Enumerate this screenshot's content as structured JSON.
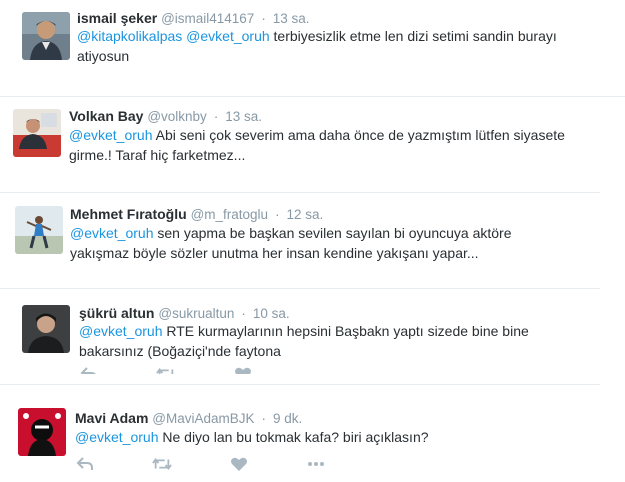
{
  "tweets": [
    {
      "name": "ismail şeker",
      "handle": "@ismail414167",
      "time": "13 sa.",
      "text_lines": [
        [
          {
            "t": "@kitapkolikalpas",
            "m": true
          },
          {
            "t": " ",
            "m": false
          },
          {
            "t": "@evket_oruh",
            "m": true
          },
          {
            "t": " terbiyesizlik  etme len dizi setimi sandin burayı",
            "m": false
          }
        ],
        [
          {
            "t": "atiyosun",
            "m": false
          }
        ]
      ]
    },
    {
      "name": "Volkan Bay",
      "handle": "@volknby",
      "time": "13 sa.",
      "text_lines": [
        [
          {
            "t": "@evket_oruh",
            "m": true
          },
          {
            "t": " Abi seni çok severim ama daha önce de yazmıştım lütfen siyasete",
            "m": false
          }
        ],
        [
          {
            "t": "girme.! Taraf hiç farketmez...",
            "m": false
          }
        ]
      ]
    },
    {
      "name": "Mehmet Fıratoğlu",
      "handle": "@m_fratoglu",
      "time": "12 sa.",
      "text_lines": [
        [
          {
            "t": "@evket_oruh",
            "m": true
          },
          {
            "t": " sen yapma be başkan sevilen sayılan bi oyuncuya aktöre",
            "m": false
          }
        ],
        [
          {
            "t": "yakışmaz böyle sözler unutma her insan kendine yakışanı yapar...",
            "m": false
          }
        ]
      ]
    },
    {
      "name": "şükrü altun",
      "handle": "@sukrualtun",
      "time": "10 sa.",
      "text_lines": [
        [
          {
            "t": "@evket_oruh",
            "m": true
          },
          {
            "t": " RTE kurmaylarının hepsini Başbakn yaptı sizede bine bine",
            "m": false
          }
        ],
        [
          {
            "t": "bakarsınız (Boğaziçi'nde faytona",
            "m": false
          }
        ]
      ]
    },
    {
      "name": "Mavi Adam",
      "handle": "@MaviAdamBJK",
      "time": "9 dk.",
      "text_lines": [
        [
          {
            "t": "@evket_oruh",
            "m": true
          },
          {
            "t": " Ne diyo lan bu tokmak kafa? biri açıklasın?",
            "m": false
          }
        ]
      ]
    }
  ],
  "action_icons": [
    "reply-icon",
    "retweet-icon",
    "like-icon",
    "more-icon"
  ],
  "colors": {
    "mention": "#1b95e0",
    "name": "#292f33",
    "meta": "#8899a6",
    "divider": "#e6ecf0",
    "action": "#aab8c2"
  }
}
